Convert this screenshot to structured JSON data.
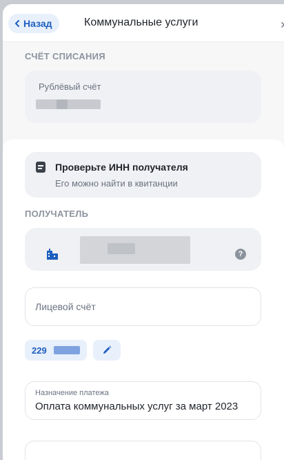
{
  "header": {
    "back_label": "Назад",
    "title": "Коммунальные услуги"
  },
  "debit_section": {
    "label": "СЧЁТ СПИСАНИЯ",
    "account_label": "Рублёвый счёт"
  },
  "inn_notice": {
    "title": "Проверьте ИНН получателя",
    "subtitle": "Его можно найти в квитанции"
  },
  "recipient_section": {
    "label": "ПОЛУЧАТЕЛЬ"
  },
  "personal_account": {
    "placeholder": "Лицевой счёт"
  },
  "account_chip": {
    "prefix": "229"
  },
  "payment_purpose": {
    "label": "Назначение платежа",
    "value": "Оплата коммунальных услуг за март 2023"
  },
  "colors": {
    "accent": "#1e5fbf",
    "accent_bg": "#e8f0fb",
    "card_bg": "#f0f1f4"
  }
}
